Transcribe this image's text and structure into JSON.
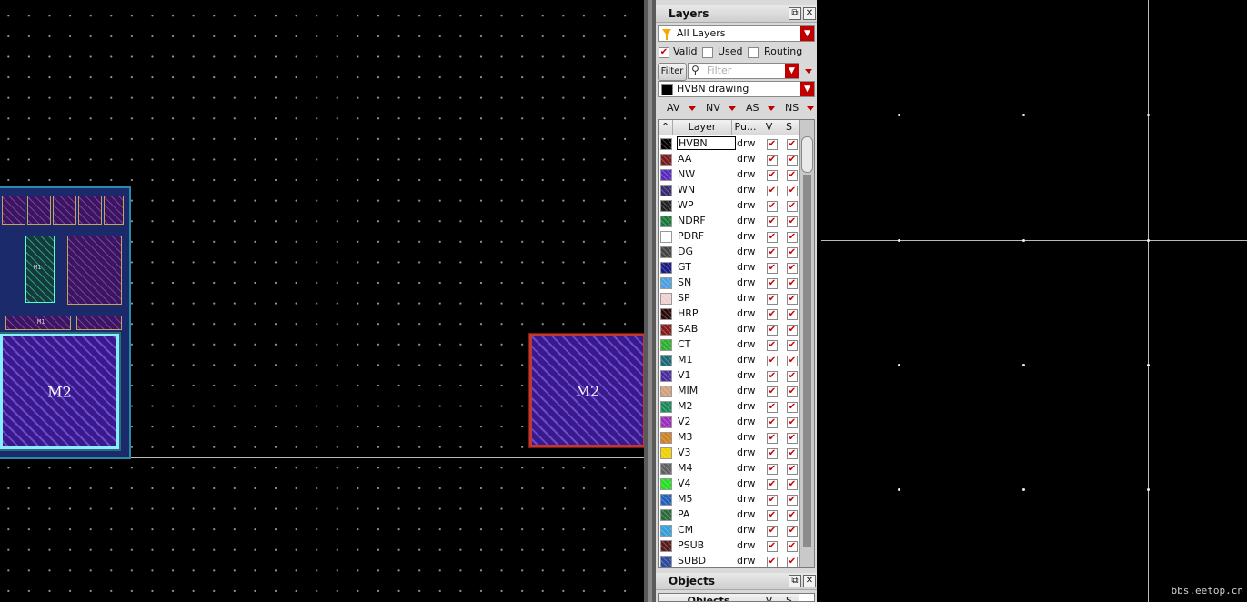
{
  "layers_panel": {
    "title": "Layers",
    "filter_combo": "All Layers",
    "checks": [
      {
        "label": "Valid",
        "checked": true
      },
      {
        "label": "Used",
        "checked": false
      },
      {
        "label": "Routing",
        "checked": false
      }
    ],
    "filter_button": "Filter",
    "filter_placeholder": "Filter",
    "current_layer": "HVBN drawing",
    "abbr_buttons": [
      "AV",
      "NV",
      "AS",
      "NS"
    ],
    "columns": [
      "Layer",
      "Pu...",
      "V",
      "S"
    ],
    "rows": [
      {
        "name": "HVBN",
        "purpose": "drw",
        "color": "#000000"
      },
      {
        "name": "AA",
        "purpose": "drw",
        "color": "#7a1a1a"
      },
      {
        "name": "NW",
        "purpose": "drw",
        "color": "#5a2ac0"
      },
      {
        "name": "WN",
        "purpose": "drw",
        "color": "#3a2a70"
      },
      {
        "name": "WP",
        "purpose": "drw",
        "color": "#222222"
      },
      {
        "name": "NDRF",
        "purpose": "drw",
        "color": "#1a7a3a"
      },
      {
        "name": "PDRF",
        "purpose": "drw",
        "color": "#ffffff"
      },
      {
        "name": "DG",
        "purpose": "drw",
        "color": "#444444"
      },
      {
        "name": "GT",
        "purpose": "drw",
        "color": "#1a1a8a"
      },
      {
        "name": "SN",
        "purpose": "drw",
        "color": "#4aa0e0"
      },
      {
        "name": "SP",
        "purpose": "drw",
        "color": "#f0d0d0"
      },
      {
        "name": "HRP",
        "purpose": "drw",
        "color": "#2a0a0a"
      },
      {
        "name": "SAB",
        "purpose": "drw",
        "color": "#8a1a1a"
      },
      {
        "name": "CT",
        "purpose": "drw",
        "color": "#2ab02a"
      },
      {
        "name": "M1",
        "purpose": "drw",
        "color": "#1a6a7a"
      },
      {
        "name": "V1",
        "purpose": "drw",
        "color": "#4a2aa0"
      },
      {
        "name": "MIM",
        "purpose": "drw",
        "color": "#d0a080"
      },
      {
        "name": "M2",
        "purpose": "drw",
        "color": "#1a8a5a"
      },
      {
        "name": "V2",
        "purpose": "drw",
        "color": "#a02ac0"
      },
      {
        "name": "M3",
        "purpose": "drw",
        "color": "#d08020"
      },
      {
        "name": "V3",
        "purpose": "drw",
        "color": "#f0d000"
      },
      {
        "name": "M4",
        "purpose": "drw",
        "color": "#606060"
      },
      {
        "name": "V4",
        "purpose": "drw",
        "color": "#20e020"
      },
      {
        "name": "M5",
        "purpose": "drw",
        "color": "#2060c0"
      },
      {
        "name": "PA",
        "purpose": "drw",
        "color": "#2a6a3a"
      },
      {
        "name": "CM",
        "purpose": "drw",
        "color": "#30a0e0"
      },
      {
        "name": "PSUB",
        "purpose": "drw",
        "color": "#5a1a1a"
      },
      {
        "name": "SUBD",
        "purpose": "drw",
        "color": "#2a4aa0"
      }
    ]
  },
  "objects_panel": {
    "title": "Objects",
    "columns": [
      "Objects",
      "V",
      "S"
    ]
  },
  "canvas": {
    "block_left_label": "M2",
    "block_right_label": "M2",
    "subcell_label_1": "M1",
    "subcell_label_2": "M1"
  },
  "watermark": "bbs.eetop.cn"
}
